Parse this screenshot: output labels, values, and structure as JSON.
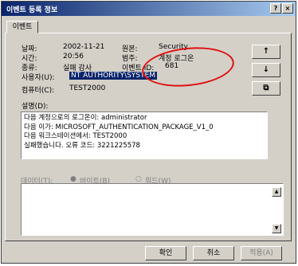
{
  "window": {
    "title": "이벤트 등록 정보",
    "help_btn": "?",
    "close_btn": "×"
  },
  "tab": {
    "label": "이벤트"
  },
  "fields": {
    "date_label": "날짜:",
    "date_value": "2002-11-21",
    "time_label": "시간:",
    "time_value": "20:56",
    "type_label": "종류:",
    "type_value": "실패 감사",
    "user_label": "사용자(U):",
    "user_value": "NT AUTHORITY\\SYSTEM",
    "computer_label": "컴퓨터(C):",
    "computer_value": "TEST2000",
    "source_label": "원본:",
    "source_value": "Security",
    "category_label": "범주:",
    "category_value": "계정 로그온",
    "eventid_label": "이벤트 ID:",
    "eventid_value": "681"
  },
  "nav": {
    "up": "↑",
    "down": "↓",
    "copy": "⧉"
  },
  "description": {
    "label": "설명(D):",
    "lines": [
      "다음 계정으로의 로그온이: administrator",
      "다음 이가: MICROSOFT_AUTHENTICATION_PACKAGE_V1_0",
      "다음 워크스테이션에서: TEST2000",
      "실패했습니다. 오류 코드: 3221225578"
    ]
  },
  "data_section": {
    "label": "데이터(T):",
    "bytes_option": "바이트(B)",
    "words_option": "워드(W)"
  },
  "buttons": {
    "ok": "확인",
    "cancel": "취소",
    "apply": "적용(A)"
  },
  "annotation": {
    "color": "#e01010"
  }
}
